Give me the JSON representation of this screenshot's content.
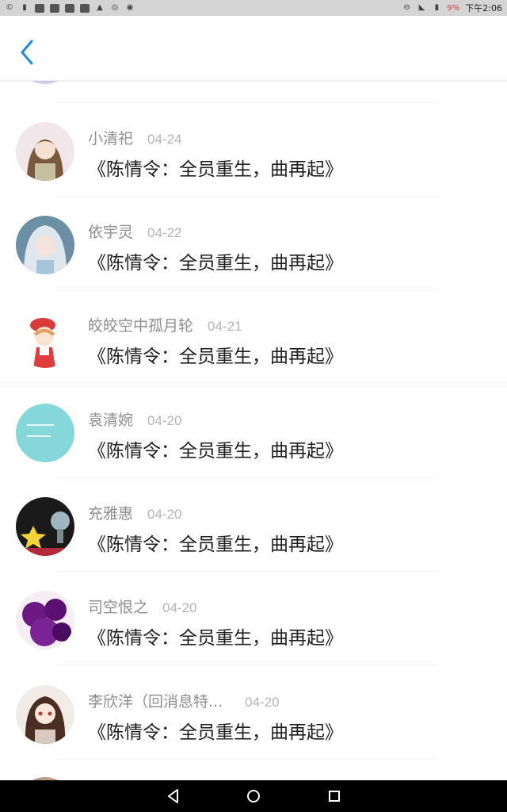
{
  "status_bar": {
    "battery": "9%",
    "time": "下午2:06"
  },
  "header": {
    "back_icon": "chevron-left-icon",
    "accent_color": "#1e88e5"
  },
  "list": {
    "items": [
      {
        "name": "小清祀",
        "date": "04-24",
        "message": "《陈情令：全员重生，曲再起》"
      },
      {
        "name": "依宇灵",
        "date": "04-22",
        "message": "《陈情令：全员重生，曲再起》"
      },
      {
        "name": "皎皎空中孤月轮",
        "date": "04-21",
        "message": "《陈情令：全员重生，曲再起》"
      },
      {
        "name": "袁清婉",
        "date": "04-20",
        "message": "《陈情令：全员重生，曲再起》"
      },
      {
        "name": "充雅惠",
        "date": "04-20",
        "message": "《陈情令：全员重生，曲再起》"
      },
      {
        "name": "司空恨之",
        "date": "04-20",
        "message": "《陈情令：全员重生，曲再起》"
      },
      {
        "name": "李欣洋（回消息特...",
        "date": "04-20",
        "message": "《陈情令：全员重生，曲再起》"
      }
    ]
  },
  "nav_bar": {
    "back": "triangle-back-icon",
    "home": "circle-home-icon",
    "recents": "square-recents-icon"
  }
}
